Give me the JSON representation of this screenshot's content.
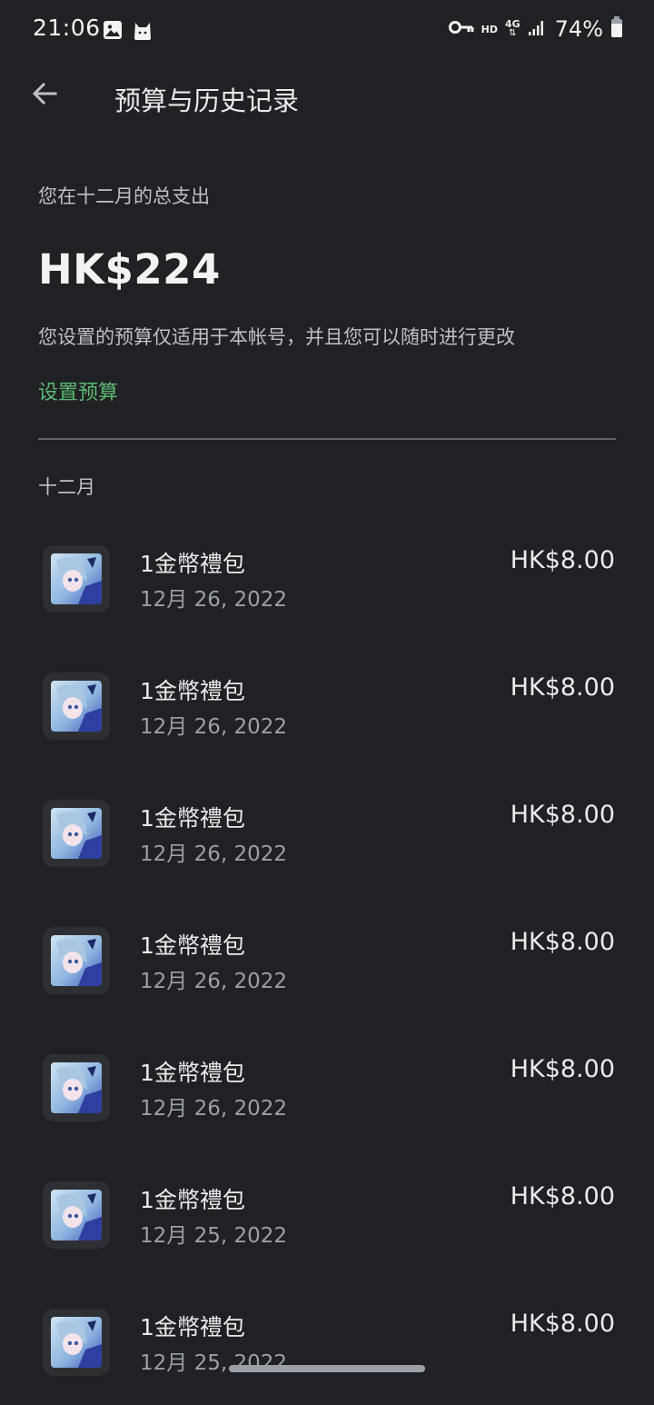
{
  "status": {
    "time": "21:06",
    "hd": "HD",
    "network": "4G",
    "battery": "74%"
  },
  "header": {
    "title": "预算与历史记录"
  },
  "summary": {
    "label": "您在十二月的总支出",
    "amount": "HK$224",
    "note": "您设置的预算仅适用于本帐号，并且您可以随时进行更改",
    "set_budget": "设置预算"
  },
  "month_header": "十二月",
  "transactions": [
    {
      "title": "1金幣禮包",
      "date": "12月 26, 2022",
      "price": "HK$8.00"
    },
    {
      "title": "1金幣禮包",
      "date": "12月 26, 2022",
      "price": "HK$8.00"
    },
    {
      "title": "1金幣禮包",
      "date": "12月 26, 2022",
      "price": "HK$8.00"
    },
    {
      "title": "1金幣禮包",
      "date": "12月 26, 2022",
      "price": "HK$8.00"
    },
    {
      "title": "1金幣禮包",
      "date": "12月 26, 2022",
      "price": "HK$8.00"
    },
    {
      "title": "1金幣禮包",
      "date": "12月 25, 2022",
      "price": "HK$8.00"
    },
    {
      "title": "1金幣禮包",
      "date": "12月 25, 2022",
      "price": "HK$8.00"
    }
  ],
  "colors": {
    "background": "#202124",
    "accent_green": "#5bb974",
    "text_primary": "#e8eaed",
    "text_secondary": "#9aa0a6"
  },
  "icons": {
    "back": "arrow-back-icon",
    "gallery": "image-icon",
    "cat": "cat-icon",
    "vpn_key": "key-icon",
    "signal": "signal-icon",
    "battery": "battery-icon"
  }
}
